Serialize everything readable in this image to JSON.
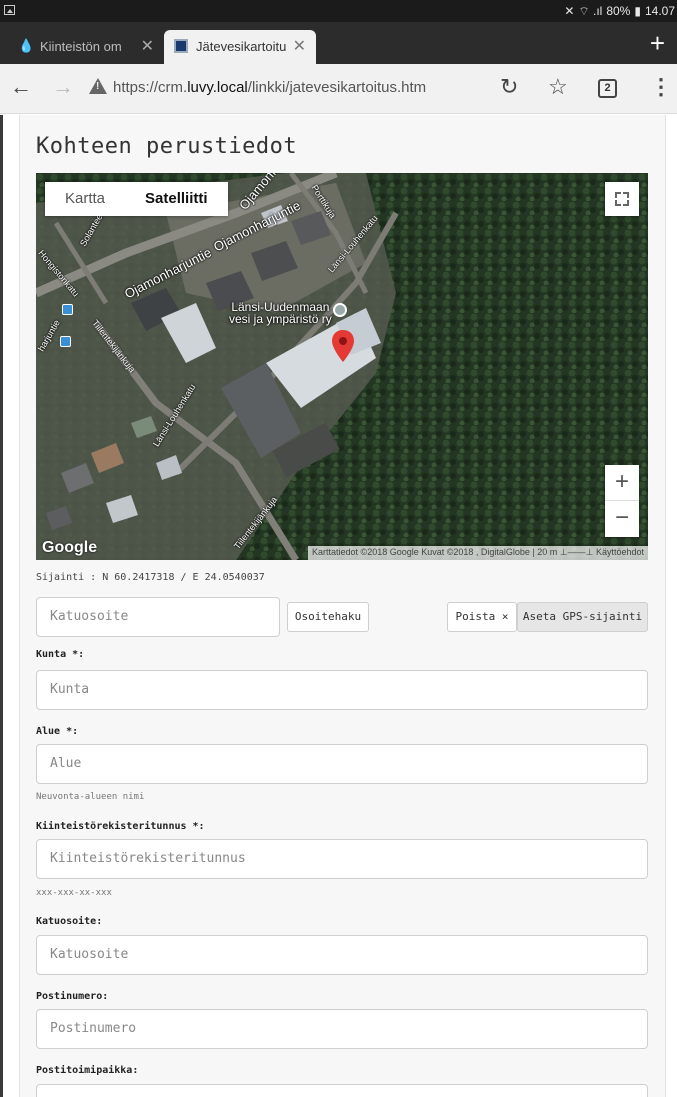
{
  "statusbar": {
    "bluetooth": "✕",
    "signal": "⌔ .ıl",
    "battery": "80%",
    "time": "14.07"
  },
  "tabs": [
    {
      "title": "Kiinteistön om",
      "active": false
    },
    {
      "title": "Jätevesikartoitu",
      "active": true
    }
  ],
  "newtab_label": "+",
  "address": {
    "url_prefix": "https://crm.",
    "url_domain": "luvy.local",
    "url_path": "/linkki/jatevesikartoitus.htm",
    "tab_count": "2"
  },
  "page": {
    "heading": "Kohteen perustiedot",
    "map": {
      "type_map": "Kartta",
      "type_satellite": "Satelliitti",
      "selected_type": "Satelliitti",
      "zoom_in": "+",
      "zoom_out": "−",
      "logo": "Google",
      "attribution": "Karttatiedot ©2018 Google Kuvat ©2018 , DigitalGlobe | 20 m ⊥——⊥ Käyttöehdot",
      "place_line1": "Länsi-Uudenmaan",
      "place_line2": "vesi ja ympäristö ry",
      "streets": {
        "ojamonharjuntie": "Ojamonharjuntie",
        "ojamonharjuntie2": "Ojamonharjuntie",
        "ojamon_top": "Ojamonharjuntie",
        "solanteenkatu": "Solanteenkatu",
        "hongistonkatu": "Hongistonkatu",
        "porttikuja": "Porttikuja",
        "lansi_louhenkatu_1": "Länsi-Louhenkatu",
        "lansi_louhenkatu_2": "Länsi-Louhenkatu",
        "lansi_louhenkatu_3": "Länsi-Louhenkatu",
        "tiilentekijankuja": "Tiilentekijänkuja",
        "tiilentekijankuja2": "Tiilentekijänkuja",
        "harjuntie": "harjuntie"
      }
    },
    "location": "Sijainti : N 60.2417318 / E 24.0540037",
    "address_search": {
      "placeholder": "Katuosoite",
      "search_button": "Osoitehaku",
      "remove_button": "Poista ×",
      "gps_button": "Aseta GPS-sijainti"
    },
    "fields": {
      "kunta": {
        "label": "Kunta *:",
        "placeholder": "Kunta"
      },
      "alue": {
        "label": "Alue *:",
        "placeholder": "Alue",
        "help": "Neuvonta-alueen nimi"
      },
      "kiinteisto": {
        "label": "Kiinteistörekisteritunnus *:",
        "placeholder": "Kiinteistörekisteritunnus",
        "help": "xxx-xxx-xx-xxx"
      },
      "katuosoite": {
        "label": "Katuosoite:",
        "placeholder": "Katuosoite"
      },
      "postinumero": {
        "label": "Postinumero:",
        "placeholder": "Postinumero"
      },
      "postitoimipaikka": {
        "label": "Postitoimipaikka:",
        "placeholder": "Postitoimipaikka"
      }
    }
  }
}
